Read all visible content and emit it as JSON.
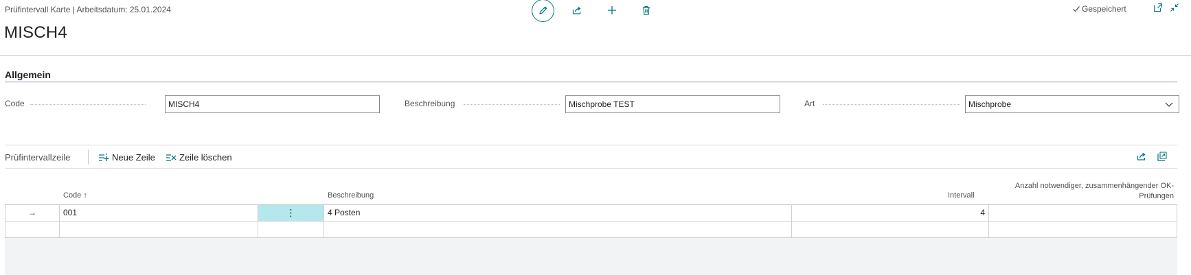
{
  "header": {
    "breadcrumb": "Prüfintervall Karte | Arbeitsdatum: 25.01.2024",
    "title": "MISCH4",
    "saved_status": "Gespeichert",
    "actions": [
      "edit-icon",
      "share-icon",
      "new-icon",
      "delete-icon"
    ]
  },
  "general": {
    "section_title": "Allgemein",
    "fields": {
      "code": {
        "label": "Code",
        "value": "MISCH4"
      },
      "description": {
        "label": "Beschreibung",
        "value": "Mischprobe TEST"
      },
      "type": {
        "label": "Art",
        "value": "Mischprobe"
      }
    }
  },
  "lines": {
    "title": "Prüfintervallzeile",
    "new_line": "Neue Zeile",
    "delete_line": "Zeile löschen",
    "columns": {
      "code": "Code",
      "sort_indicator": "↑",
      "description": "Beschreibung",
      "interval": "Intervall",
      "required_ok_line1": "Anzahl notwendiger, zusammenhängender OK-",
      "required_ok_line2": "Prüfungen"
    },
    "rows": [
      {
        "marker": "→",
        "code": "001",
        "menu": "⋮",
        "description": "4 Posten",
        "interval": "4",
        "required_ok": ""
      },
      {
        "marker": "",
        "code": "",
        "menu": "",
        "description": "",
        "interval": "",
        "required_ok": ""
      }
    ]
  },
  "colors": {
    "accent": "#00757a",
    "selected_cell": "#b4e8ec"
  }
}
